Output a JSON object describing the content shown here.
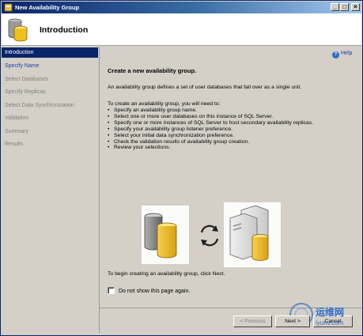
{
  "window": {
    "title": "New Availability Group"
  },
  "header": {
    "title": "Introduction"
  },
  "nav": {
    "items": [
      {
        "label": "Introduction",
        "state": "active"
      },
      {
        "label": "Specify Name",
        "state": "link"
      },
      {
        "label": "Select Databases",
        "state": "disabled"
      },
      {
        "label": "Specify Replicas",
        "state": "disabled"
      },
      {
        "label": "Select Data Synchronization",
        "state": "disabled"
      },
      {
        "label": "Validation",
        "state": "disabled"
      },
      {
        "label": "Summary",
        "state": "disabled"
      },
      {
        "label": "Results",
        "state": "disabled"
      }
    ]
  },
  "help": {
    "label": "Help",
    "icon": "help-circle-icon"
  },
  "content": {
    "heading": "Create a new availability group.",
    "description": "An availability group defines a set of user databases that fail over as a single unit.",
    "intro": "To create an availability group, you will need to:",
    "bullets": [
      "Specify an availability group name.",
      "Select one or more user databases on this instance of SQL Server.",
      "Specify one or more instances of SQL Server to host secondary availability replicas.",
      "Specify your availability group listener preference.",
      "Select your initial data synchronization preference.",
      "Check the validation results of availability group creation.",
      "Review your selections."
    ],
    "begin_text": "To begin creating an availability group, click Next.",
    "checkbox_label": "Do not show this page again.",
    "checkbox_checked": false
  },
  "buttons": {
    "previous": "< Previous",
    "next": "Next >",
    "cancel": "Cancel"
  },
  "watermark": {
    "cn": "运维网",
    "en": "iyunv.com"
  },
  "colors": {
    "active_nav": "#0a246a",
    "link": "#1f3f9f",
    "chrome": "#d4d0c8"
  }
}
